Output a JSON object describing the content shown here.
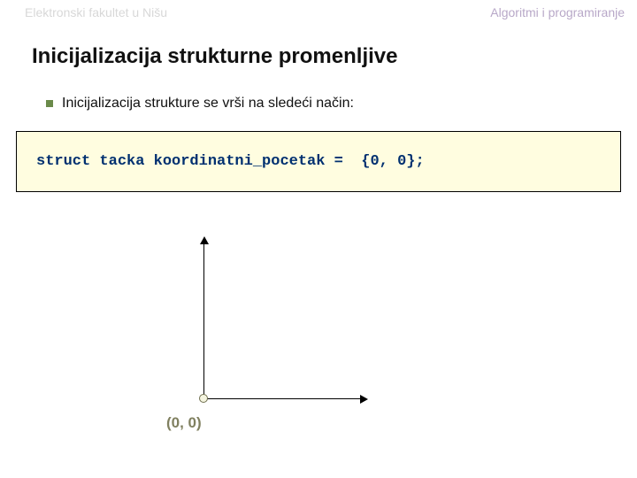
{
  "header": {
    "left": "Elektronski fakultet u Nišu",
    "right": "Algoritmi i programiranje"
  },
  "title": "Inicijalizacija strukturne promenljive",
  "bullet": "Inicijalizacija strukture se vrši na sledeći način:",
  "code": "struct tacka koordinatni_pocetak =  {0, 0};",
  "origin_label": "(0, 0)"
}
